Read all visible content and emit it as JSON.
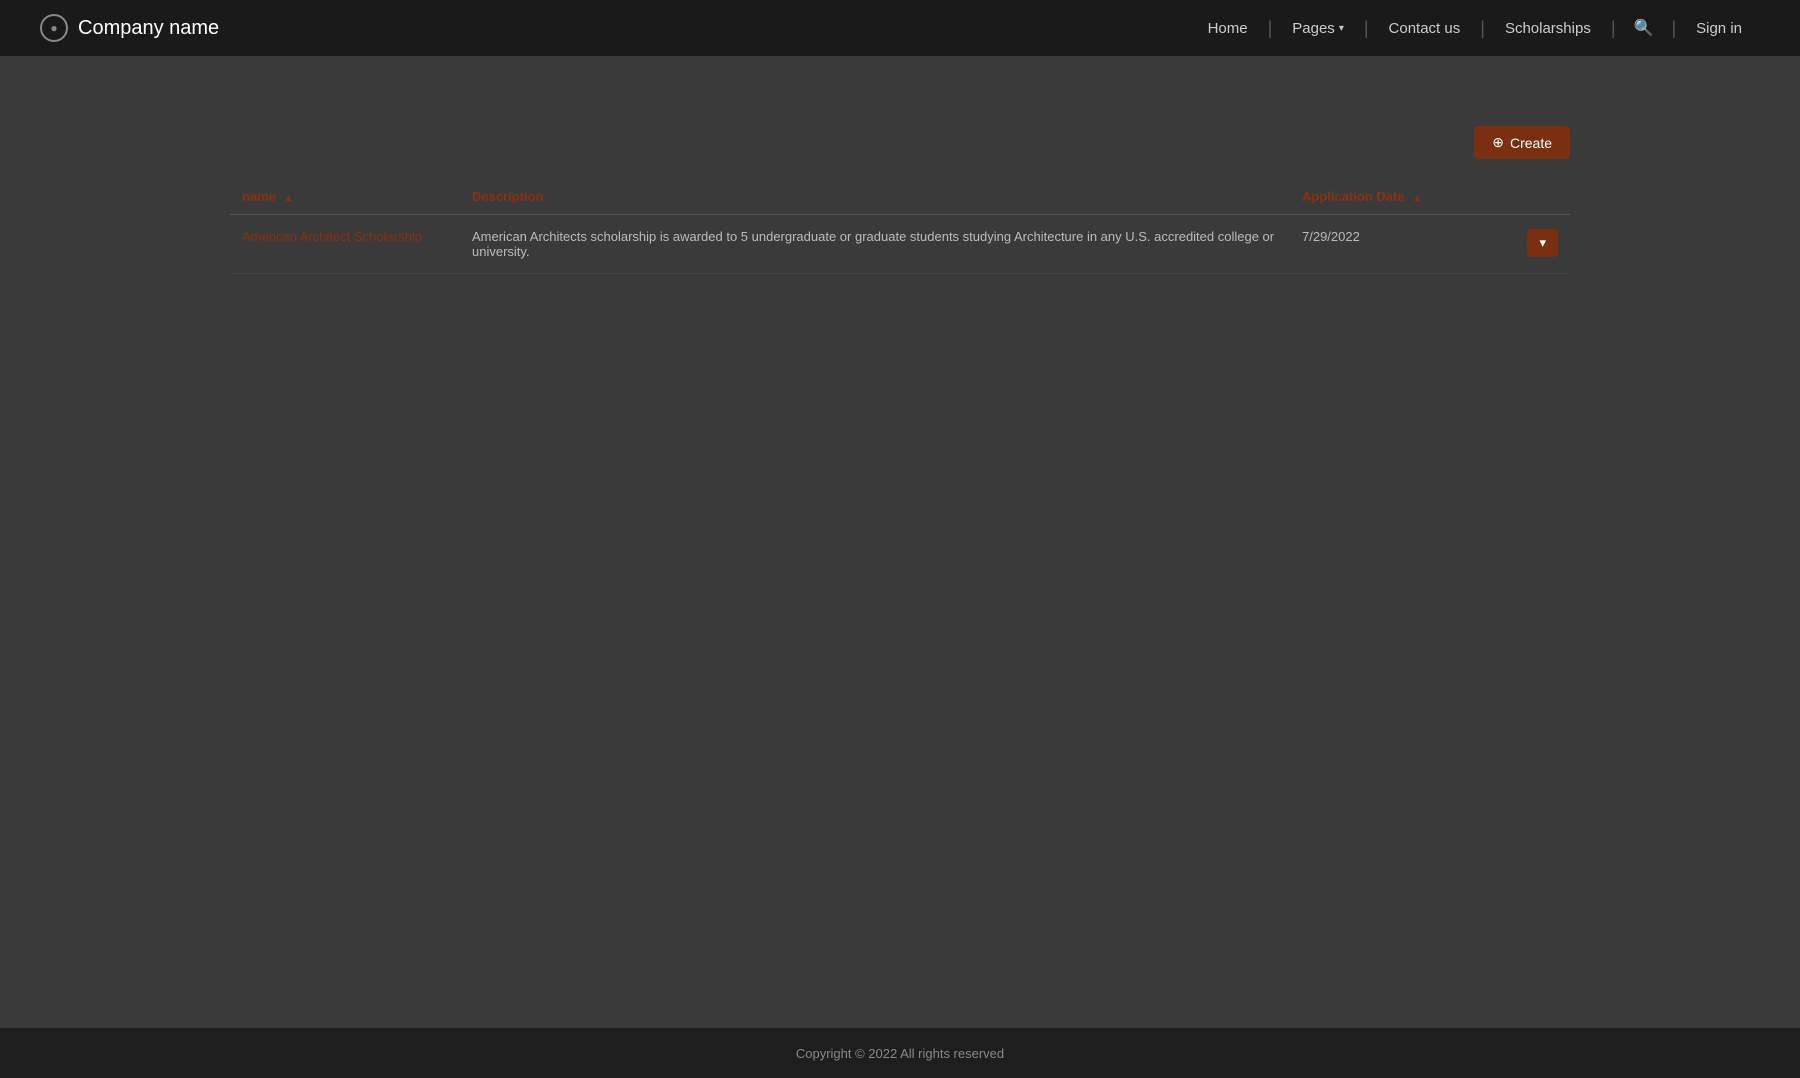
{
  "brand": {
    "icon_label": "●",
    "name": "Company name"
  },
  "navbar": {
    "home_label": "Home",
    "pages_label": "Pages",
    "contact_label": "Contact us",
    "scholarships_label": "Scholarships",
    "signin_label": "Sign in"
  },
  "create_button": {
    "label": "Create",
    "icon": "⊕"
  },
  "table": {
    "columns": [
      {
        "key": "name",
        "label": "name",
        "sort": true
      },
      {
        "key": "description",
        "label": "Description",
        "sort": false
      },
      {
        "key": "application_date",
        "label": "Application Date",
        "sort": true
      }
    ],
    "rows": [
      {
        "name": "American Architect Scholarship",
        "description": "American Architects scholarship is awarded to 5 undergraduate or graduate students studying Architecture in any U.S. accredited college or university.",
        "application_date": "7/29/2022"
      }
    ]
  },
  "row_action": {
    "icon": "▾"
  },
  "footer": {
    "copyright": "Copyright © 2022  All rights reserved"
  }
}
